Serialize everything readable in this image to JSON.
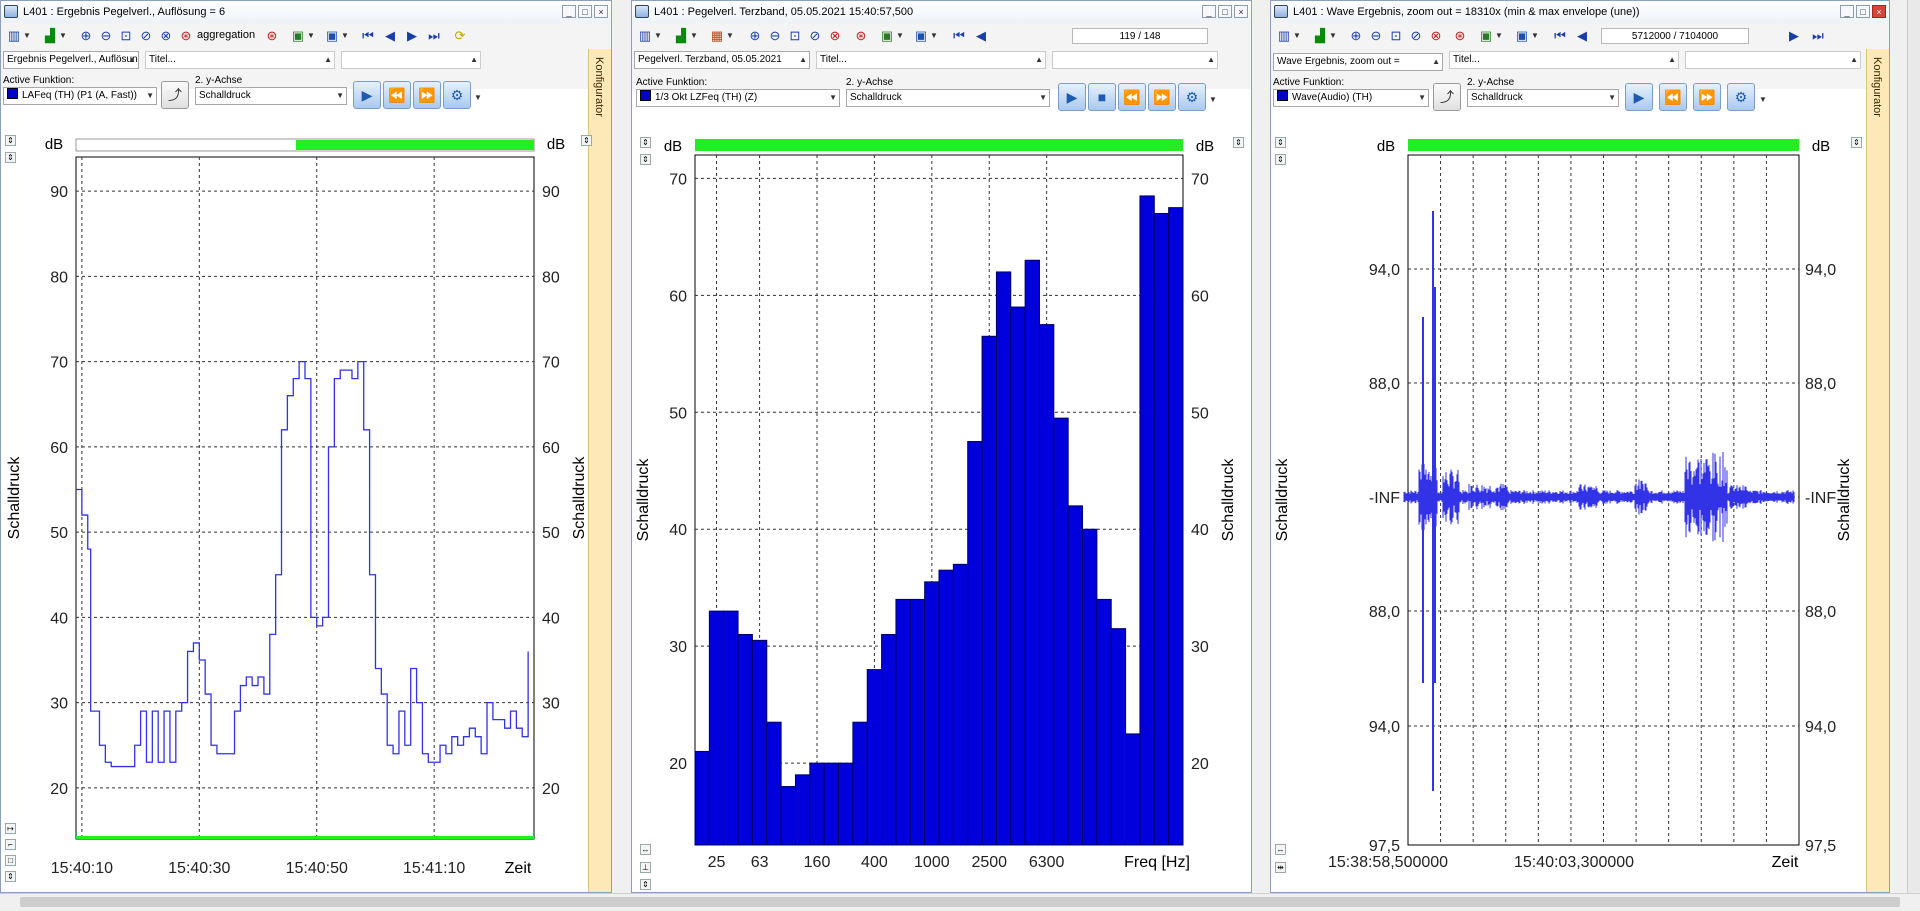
{
  "colors": {
    "series": "#3232e6",
    "bar": "#0000dc",
    "bar_edge": "#000060",
    "level": "#22ee22",
    "konfig": "#fde8b8"
  },
  "windows": [
    {
      "title": "L401 : Ergebnis Pegelverl., Auflösung = 6",
      "toolbar_text": "aggregation",
      "source_combo": "Ergebnis Pegelverl., Auflösung",
      "title_field": "Titel...",
      "active_label": "Active Funktion:",
      "active_value": "LAFeq (TH) (P1 (A, Fast))",
      "yaxis2_label": "2. y-Achse",
      "yaxis2_value": "Schalldruck",
      "konfigurator": "Konfigurator"
    },
    {
      "title": "L401 : Pegelverl. Terzband, 05.05.2021 15:40:57,500",
      "nav_counter": "119 / 148",
      "source_combo": "Pegelverl. Terzband, 05.05.2021",
      "title_field": "Titel...",
      "active_label": "Active Funktion:",
      "active_value": "1/3 Okt LZFeq (TH) (Z)",
      "yaxis2_label": "2. y-Achse",
      "yaxis2_value": "Schalldruck"
    },
    {
      "title": "L401 : Wave Ergebnis, zoom out = 18310x (min & max envelope (une))",
      "nav_counter": "5712000 / 7104000",
      "source_combo": "Wave Ergebnis, zoom out =",
      "title_field": "Titel...",
      "active_label": "Active Funktion:",
      "active_value": "Wave(Audio) (TH)",
      "yaxis2_label": "2. y-Achse",
      "yaxis2_value": "Schalldruck",
      "konfigurator": "Konfigurator"
    }
  ],
  "chart_data": [
    {
      "type": "line",
      "title": "",
      "unit": "dB",
      "ylabel": "Schalldruck",
      "ylabel_right": "Schalldruck",
      "xlabel": "Zeit",
      "x_ticks": [
        "15:40:10",
        "15:40:30",
        "15:40:50",
        "15:41:10"
      ],
      "x_tick_pos_s": [
        0,
        20,
        40,
        60
      ],
      "xlim_s": [
        -1,
        77
      ],
      "ylim": [
        14,
        94
      ],
      "y_ticks": [
        20,
        30,
        40,
        50,
        60,
        70,
        80,
        90
      ],
      "grid": true,
      "series": [
        {
          "values": [
            [
              -1,
              55
            ],
            [
              0,
              52
            ],
            [
              1,
              48
            ],
            [
              1.5,
              29
            ],
            [
              3,
              25
            ],
            [
              4,
              23
            ],
            [
              5,
              22.5
            ],
            [
              8,
              22.5
            ],
            [
              9,
              25
            ],
            [
              10,
              29
            ],
            [
              11,
              23
            ],
            [
              12,
              29
            ],
            [
              13,
              23
            ],
            [
              14,
              29
            ],
            [
              15,
              23
            ],
            [
              16,
              29
            ],
            [
              17,
              30
            ],
            [
              18,
              36
            ],
            [
              19,
              37
            ],
            [
              20,
              35
            ],
            [
              21,
              31
            ],
            [
              22,
              25
            ],
            [
              23,
              24
            ],
            [
              25,
              24
            ],
            [
              26,
              29
            ],
            [
              27,
              32
            ],
            [
              28,
              33
            ],
            [
              29,
              32
            ],
            [
              30,
              33
            ],
            [
              31,
              31
            ],
            [
              32,
              38
            ],
            [
              33,
              45
            ],
            [
              34,
              62
            ],
            [
              35,
              66
            ],
            [
              36,
              68
            ],
            [
              37,
              70
            ],
            [
              38,
              68
            ],
            [
              39,
              40
            ],
            [
              40,
              39
            ],
            [
              41,
              40
            ],
            [
              42,
              60
            ],
            [
              43,
              68
            ],
            [
              44,
              69
            ],
            [
              45,
              69
            ],
            [
              46,
              68
            ],
            [
              47,
              70
            ],
            [
              48,
              62
            ],
            [
              49,
              45
            ],
            [
              50,
              34
            ],
            [
              51,
              31
            ],
            [
              52,
              25
            ],
            [
              53,
              24
            ],
            [
              54,
              29
            ],
            [
              55,
              25
            ],
            [
              56,
              34
            ],
            [
              57,
              30
            ],
            [
              58,
              24
            ],
            [
              59,
              23
            ],
            [
              60,
              23
            ],
            [
              61,
              25
            ],
            [
              62,
              24
            ],
            [
              63,
              26
            ],
            [
              64,
              25
            ],
            [
              65,
              26
            ],
            [
              66,
              27
            ],
            [
              67,
              26
            ],
            [
              68,
              24
            ],
            [
              69,
              30
            ],
            [
              70,
              28
            ],
            [
              71,
              28
            ],
            [
              72,
              27
            ],
            [
              73,
              29
            ],
            [
              74,
              27
            ],
            [
              75,
              26
            ],
            [
              76,
              36
            ]
          ]
        }
      ],
      "level_bar_fraction": 0.52
    },
    {
      "type": "bar",
      "title": "",
      "unit": "dB",
      "ylabel": "Schalldruck",
      "xlabel": "Freq [Hz]",
      "x_tick_labels": [
        "25",
        "63",
        "160",
        "400",
        "1000",
        "2500",
        "6300"
      ],
      "x_tick_band_index": [
        1,
        4,
        8,
        12,
        16,
        20,
        24
      ],
      "ylim": [
        13,
        72
      ],
      "y_ticks": [
        20,
        30,
        40,
        50,
        60,
        70
      ],
      "grid": true,
      "values": [
        21,
        33,
        33,
        31,
        30.5,
        23.5,
        18,
        19,
        20,
        20,
        20,
        23.5,
        28,
        31,
        34,
        34,
        35.5,
        36.5,
        37,
        47.5,
        56.5,
        62,
        59,
        63,
        57.5,
        49.5,
        42,
        40,
        34,
        31.5,
        22.5,
        68.5,
        67,
        67.5
      ]
    },
    {
      "type": "line",
      "title": "",
      "unit": "dB",
      "ylabel": "Schalldruck",
      "xlabel": "Zeit",
      "x_ticks": [
        "15:38:58,500000",
        "15:40:03,300000"
      ],
      "y_tick_labels": [
        "94,0",
        "88,0",
        "-INF",
        "88,0",
        "94,0",
        "97,5"
      ],
      "y_tick_values": [
        94,
        88,
        0,
        -88,
        -94,
        -97.5
      ],
      "grid": true,
      "series": [
        {
          "name": "Wave(Audio) (TH)"
        }
      ]
    }
  ]
}
